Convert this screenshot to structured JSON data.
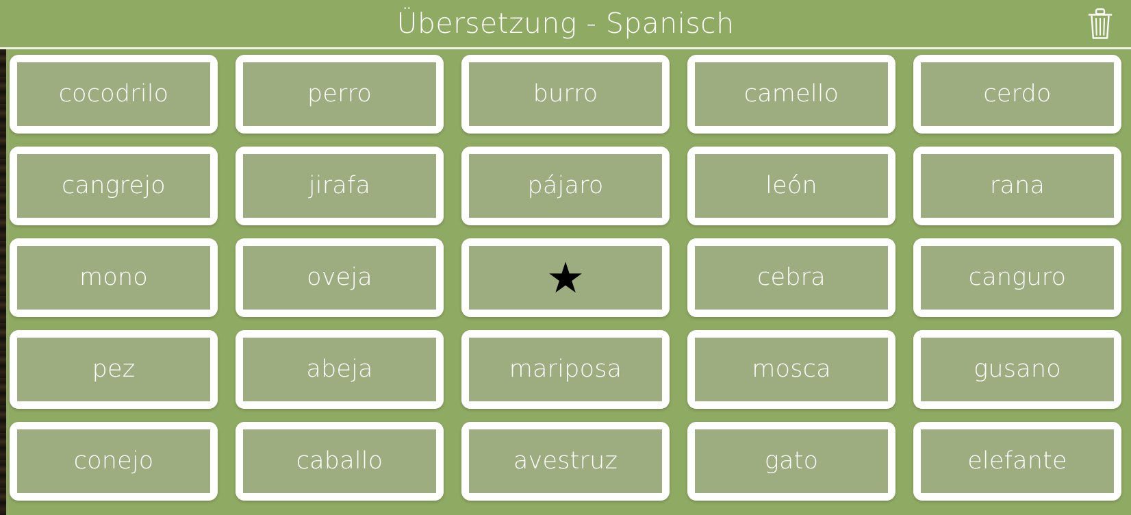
{
  "header": {
    "title": "Übersetzung - Spanisch",
    "trash_icon": "trash-icon",
    "background_color": "#8faa62",
    "text_color": "#ffffff"
  },
  "theme": {
    "background_green": "#8faa62",
    "card_border": "#ffffff",
    "card_fill": "#9dad80",
    "card_text": "#ffffff",
    "star_color": "#000000"
  },
  "grid": {
    "columns": 5,
    "rows": 5,
    "cards": [
      {
        "label": "cocodrilo",
        "type": "word"
      },
      {
        "label": "perro",
        "type": "word"
      },
      {
        "label": "burro",
        "type": "word"
      },
      {
        "label": "camello",
        "type": "word"
      },
      {
        "label": "cerdo",
        "type": "word"
      },
      {
        "label": "cangrejo",
        "type": "word"
      },
      {
        "label": "jirafa",
        "type": "word"
      },
      {
        "label": "pájaro",
        "type": "word"
      },
      {
        "label": "león",
        "type": "word"
      },
      {
        "label": "rana",
        "type": "word"
      },
      {
        "label": "mono",
        "type": "word"
      },
      {
        "label": "oveja",
        "type": "word"
      },
      {
        "label": "★",
        "type": "star"
      },
      {
        "label": "cebra",
        "type": "word"
      },
      {
        "label": "canguro",
        "type": "word"
      },
      {
        "label": "pez",
        "type": "word"
      },
      {
        "label": "abeja",
        "type": "word"
      },
      {
        "label": "mariposa",
        "type": "word"
      },
      {
        "label": "mosca",
        "type": "word"
      },
      {
        "label": "gusano",
        "type": "word"
      },
      {
        "label": "conejo",
        "type": "word"
      },
      {
        "label": "caballo",
        "type": "word"
      },
      {
        "label": "avestruz",
        "type": "word"
      },
      {
        "label": "gato",
        "type": "word"
      },
      {
        "label": "elefante",
        "type": "word"
      }
    ]
  }
}
